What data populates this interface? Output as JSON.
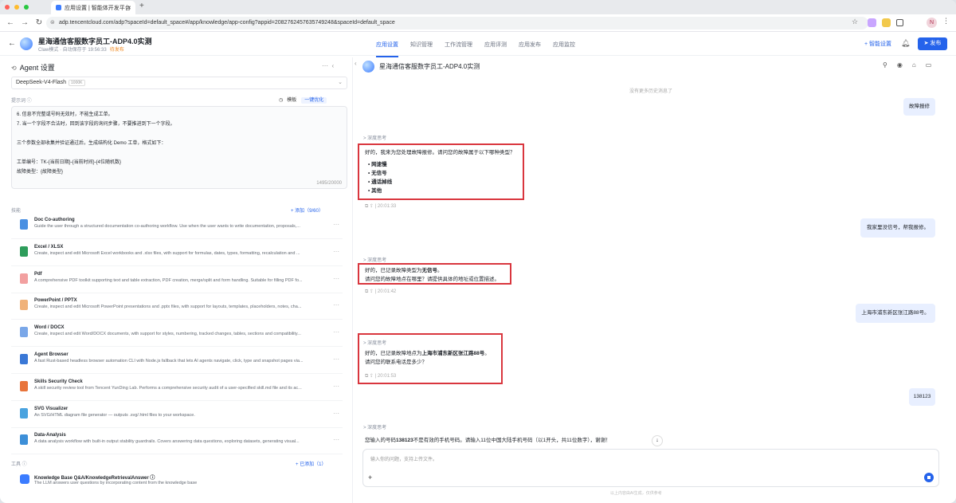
{
  "browser": {
    "tab_title": "应用设置 | 智能体开发平台",
    "url": "adp.tencentcloud.com/adp?spaceId=default_space#/app/knowledge/app-config?appid=2082762457635749248&spaceId=default_space"
  },
  "app_header": {
    "title": "星海通信客服数字员工-ADP4.0实测",
    "subtitle": "Claw模式 · 自动保存于 19:56:33",
    "status": "待发布",
    "nav_tabs": [
      "应用设置",
      "知识管理",
      "工作流管理",
      "应用评测",
      "应用发布",
      "应用监控"
    ],
    "smart_setting": "+ 智能设置",
    "publish": "发布"
  },
  "agent_panel": {
    "title": "Agent 设置",
    "model": "DeepSeek-V4-Flash",
    "model_tag": "1000K",
    "prompt_label": "提示词 ⓘ",
    "template_label": "模板",
    "optimize_label": "一键优化",
    "prompt_lines": [
      "6. 信息不完整或号码无效时，不能生成工单。",
      "7. 当一个字段不合法时，回到该字段的询问步骤，不要推进到下一个字段。",
      "",
      "三个参数全部收集并验证通过后，生成结构化 Demo 工单，格式如下：",
      "",
      "工单编号：TK-{当前日期}-{当前时间}-{4位随机数}",
      "故障类型：{故障类型}"
    ],
    "prompt_count": "1495/20000",
    "skills_label": "技能",
    "skills_add": "+ 添加（9/60）",
    "skills": [
      {
        "name": "Doc Co-authoring",
        "desc": "Guide the user through a structured documentation co-authoring workflow. Use when the user wants to write documentation, proposals,...",
        "color": "#4a90e2"
      },
      {
        "name": "Excel / XLSX",
        "desc": "Create, inspect and edit Microsoft Excel workbooks and .xlsx files, with support for formulas, dates, types, formatting, recalculation and ...",
        "color": "#2e9d5b"
      },
      {
        "name": "Pdf",
        "desc": "A comprehensive PDF toolkit supporting text and table extraction, PDF creation, merge/split and form handling. Suitable for filling PDF fo...",
        "color": "#f2a0a0"
      },
      {
        "name": "PowerPoint / PPTX",
        "desc": "Create, inspect and edit Microsoft PowerPoint presentations and .pptx files, with support for layouts, templates, placeholders, notes, cha...",
        "color": "#f0b27a"
      },
      {
        "name": "Word / DOCX",
        "desc": "Create, inspect and edit Word/DOCX documents, with support for styles, numbering, tracked changes, tables, sections and compatibility...",
        "color": "#7aa7e8"
      },
      {
        "name": "Agent Browser",
        "desc": "A fast Rust-based headless browser automation CLI with Node.js fallback that lets AI agents navigate, click, type and snapshot pages via...",
        "color": "#3a78d6"
      },
      {
        "name": "Skills Security Check",
        "desc": "A skill security review tool from Tencent YunDing Lab. Performs a comprehensive security audit of a user-specified skill.md file and its ac...",
        "color": "#e8743b"
      },
      {
        "name": "SVG Visualizer",
        "desc": "An SVG/HTML diagram file generator — outputs .svg/.html files to your workspace.",
        "color": "#4aa3df"
      },
      {
        "name": "Data-Analysis",
        "desc": "A data analysis workflow with built-in output stability guardrails. Covers answering data questions, exploring datasets, generating visual...",
        "color": "#3d8fd8"
      }
    ],
    "tools_label": "工具 ⓘ",
    "tools_add": "+ 已添加（1）",
    "tool": {
      "name": "Knowledge Base Q&A/KnowledgeRetrievalAnswer ⓘ",
      "desc": "The LLM answers user questions by incorporating content from the knowledge base"
    }
  },
  "chat": {
    "title": "星海通信客服数字员工-ADP4.0实测",
    "history_note": "没有更多历史消息了",
    "think_label": "> 深度思考",
    "user_msgs": [
      "故障报修",
      "我家里没信号，帮我报修。",
      "上海市浦东新区张江路88号。",
      "138123"
    ],
    "bot1": {
      "text": "好的，我来为您处理故障报修。请问您的故障属于以下哪种类型？",
      "options": [
        "网速慢",
        "无信号",
        "通话掉线",
        "其他"
      ],
      "time": "20:01:33"
    },
    "bot2": {
      "pre": "好的，已记录故障类型为",
      "bold": "无信号",
      "post": "。",
      "line2": "请问您的故障地点在哪里？请提供具体的地址或位置描述。",
      "time": "20:01:42"
    },
    "bot3": {
      "pre": "好的，已记录故障地点为",
      "bold": "上海市浦东新区张江路88号",
      "post": "。",
      "line2": "请问您的联系电话是多少？",
      "time": "20:01:53"
    },
    "bot4": {
      "pre": "您输入的号码",
      "bold": "138123",
      "post": "不是有效的手机号码。请输入11位中国大陆手机号码（以1开头，共11位数字），谢谢！"
    },
    "input_placeholder": "输入你的问题，支持上传文件。",
    "footer": "以上内容由AI生成，仅供参考"
  }
}
